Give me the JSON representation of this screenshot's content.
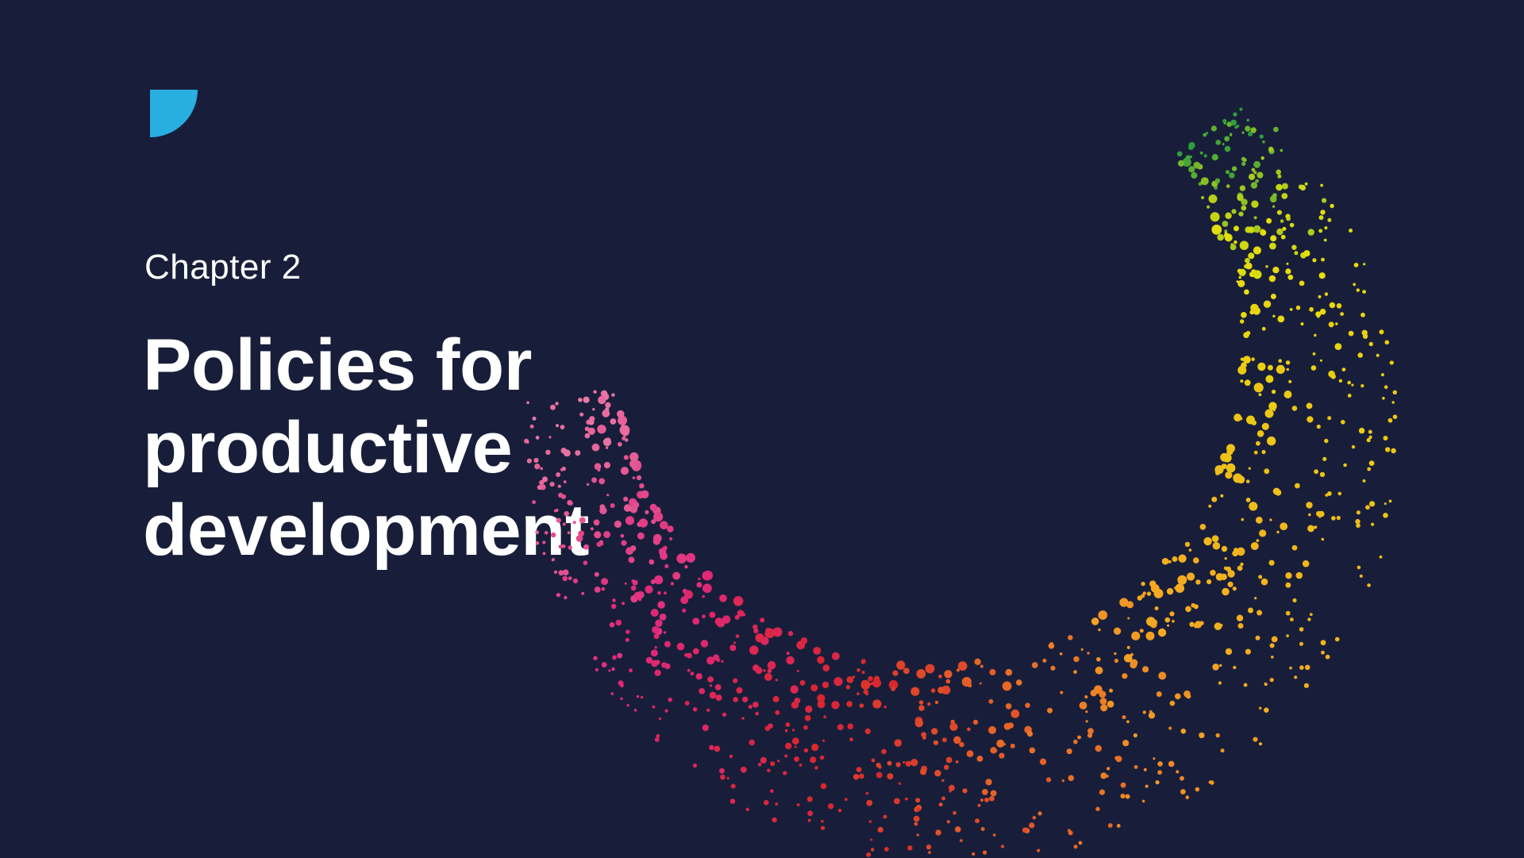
{
  "slide": {
    "chapter_label": "Chapter 2",
    "title_lines": [
      "Policies for",
      "productive",
      "development"
    ]
  },
  "logo": {
    "icon": "quarter-circle-logo-icon",
    "color": "#29aee0"
  },
  "artwork": {
    "icon": "dotted-arc-icon",
    "colors": {
      "background": "#181e3a",
      "green": "#2e9e3c",
      "yellow": "#e6e00a",
      "orange": "#f5a623",
      "red": "#d8262c",
      "magenta": "#e0287a",
      "pink": "#e87aa6"
    }
  }
}
